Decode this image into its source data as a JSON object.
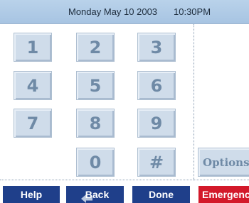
{
  "status_bar": {
    "date": "Monday May 10  2003",
    "time": "10:30PM"
  },
  "keypad": {
    "keys": [
      "1",
      "2",
      "3",
      "4",
      "5",
      "6",
      "7",
      "8",
      "9",
      "0",
      "#"
    ]
  },
  "side_panel": {
    "options_label": "Options"
  },
  "bottom_bar": {
    "help_label": "Help",
    "back_label": "Back",
    "done_label": "Done",
    "emergency_label": "Emergency"
  },
  "colors": {
    "top_bar": "#b9d2ea",
    "key_face": "#cfdcea",
    "key_text": "#6f8aa6",
    "nav_blue": "#1f3f8a",
    "emergency_red": "#d3192a"
  }
}
